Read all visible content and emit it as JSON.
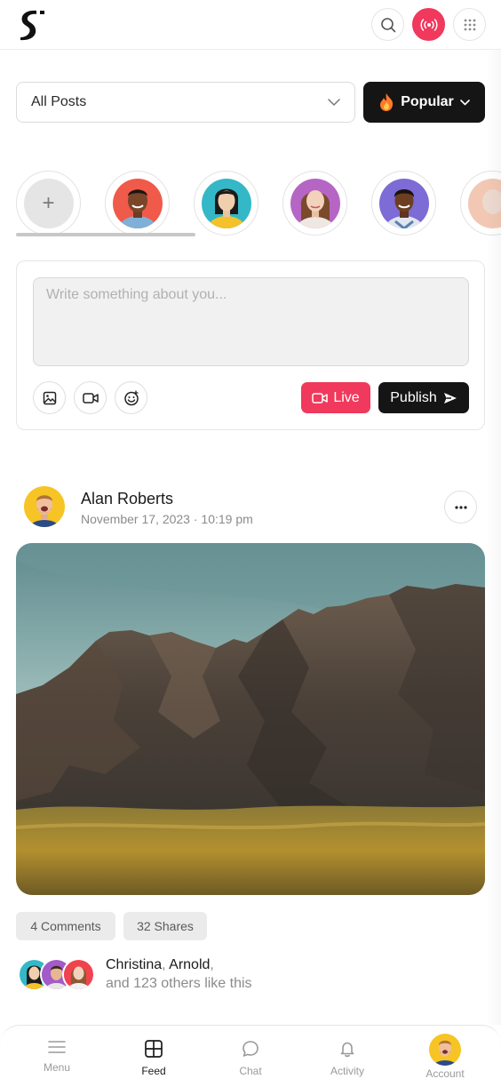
{
  "header": {
    "logo_icon": "logo-s-icon",
    "buttons": [
      "search-icon",
      "broadcast-icon",
      "apps-grid-icon"
    ],
    "accent": "#f0395c"
  },
  "filters": {
    "selected": "All Posts",
    "popular_label": "Popular"
  },
  "stories": {
    "add_label": "+",
    "items": [
      "story-1",
      "story-2",
      "story-3",
      "story-4",
      "story-5"
    ]
  },
  "composer": {
    "placeholder": "Write something about you...",
    "live_label": "Live",
    "publish_label": "Publish"
  },
  "post": {
    "author": "Alan Roberts",
    "date": "November 17, 2023 · 10:19 pm",
    "comments_label": "4 Comments",
    "shares_label": "32 Shares",
    "likers": [
      "Christina",
      "Arnold"
    ],
    "likes_suffix": "and 123 others like this"
  },
  "bottom_nav": {
    "items": [
      {
        "label": "Menu",
        "icon": "menu-icon"
      },
      {
        "label": "Feed",
        "icon": "feed-grid-icon",
        "active": true
      },
      {
        "label": "Chat",
        "icon": "chat-icon"
      },
      {
        "label": "Activity",
        "icon": "bell-icon"
      },
      {
        "label": "Account",
        "icon": "avatar"
      }
    ]
  }
}
